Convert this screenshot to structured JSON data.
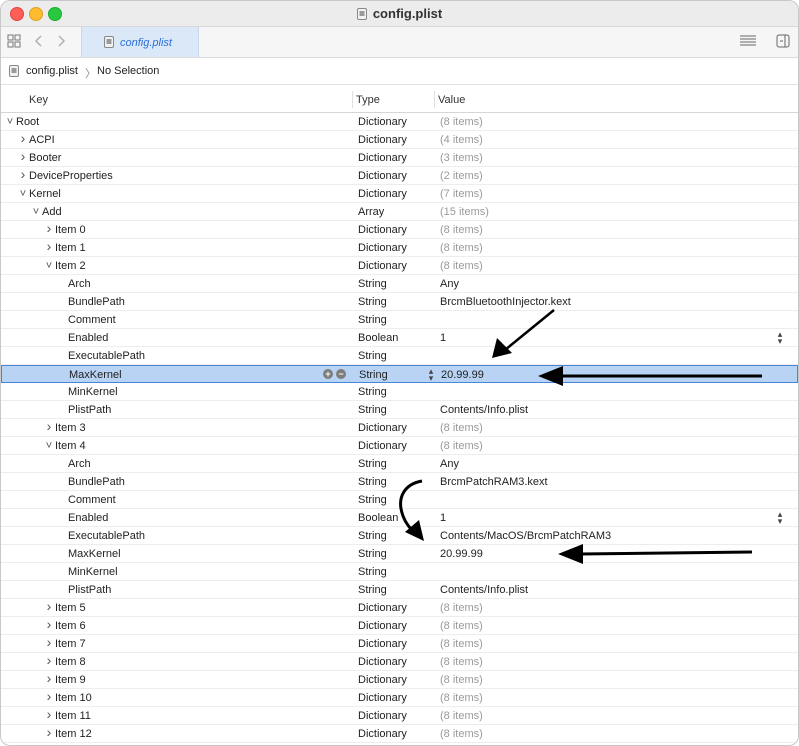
{
  "window": {
    "title": "config.plist"
  },
  "toolbar": {
    "tab_label": "config.plist",
    "grid_icon": "grid-icon",
    "back_icon": "chevron-left-icon",
    "forward_icon": "chevron-right-icon",
    "lines_icon": "lines-icon",
    "sidebar_icon": "sidebar-toggle-icon"
  },
  "breadcrumb": {
    "file": "config.plist",
    "separator": "〉",
    "selection": "No Selection"
  },
  "columns": {
    "key": "Key",
    "type": "Type",
    "value": "Value"
  },
  "rows": [
    {
      "key": "Root",
      "type": "Dictionary",
      "value": "(8 items)",
      "level": 0,
      "disc": "open"
    },
    {
      "key": "ACPI",
      "type": "Dictionary",
      "value": "(4 items)",
      "level": 1,
      "disc": "closed"
    },
    {
      "key": "Booter",
      "type": "Dictionary",
      "value": "(3 items)",
      "level": 1,
      "disc": "closed"
    },
    {
      "key": "DeviceProperties",
      "type": "Dictionary",
      "value": "(2 items)",
      "level": 1,
      "disc": "closed"
    },
    {
      "key": "Kernel",
      "type": "Dictionary",
      "value": "(7 items)",
      "level": 1,
      "disc": "open"
    },
    {
      "key": "Add",
      "type": "Array",
      "value": "(15 items)",
      "level": 2,
      "disc": "open"
    },
    {
      "key": "Item 0",
      "type": "Dictionary",
      "value": "(8 items)",
      "level": 3,
      "disc": "closed"
    },
    {
      "key": "Item 1",
      "type": "Dictionary",
      "value": "(8 items)",
      "level": 3,
      "disc": "closed"
    },
    {
      "key": "Item 2",
      "type": "Dictionary",
      "value": "(8 items)",
      "level": 3,
      "disc": "open"
    },
    {
      "key": "Arch",
      "type": "String",
      "value": "Any",
      "level": 4
    },
    {
      "key": "BundlePath",
      "type": "String",
      "value": "BrcmBluetoothInjector.kext",
      "level": 4
    },
    {
      "key": "Comment",
      "type": "String",
      "value": "",
      "level": 4
    },
    {
      "key": "Enabled",
      "type": "Boolean",
      "value": "1",
      "level": 4,
      "stepper": true
    },
    {
      "key": "ExecutablePath",
      "type": "String",
      "value": "",
      "level": 4
    },
    {
      "key": "MaxKernel",
      "type": "String",
      "value": "20.99.99",
      "level": 4,
      "selected": true
    },
    {
      "key": "MinKernel",
      "type": "String",
      "value": "",
      "level": 4
    },
    {
      "key": "PlistPath",
      "type": "String",
      "value": "Contents/Info.plist",
      "level": 4
    },
    {
      "key": "Item 3",
      "type": "Dictionary",
      "value": "(8 items)",
      "level": 3,
      "disc": "closed"
    },
    {
      "key": "Item 4",
      "type": "Dictionary",
      "value": "(8 items)",
      "level": 3,
      "disc": "open"
    },
    {
      "key": "Arch",
      "type": "String",
      "value": "Any",
      "level": 4
    },
    {
      "key": "BundlePath",
      "type": "String",
      "value": "BrcmPatchRAM3.kext",
      "level": 4
    },
    {
      "key": "Comment",
      "type": "String",
      "value": "",
      "level": 4
    },
    {
      "key": "Enabled",
      "type": "Boolean",
      "value": "1",
      "level": 4,
      "stepper": true
    },
    {
      "key": "ExecutablePath",
      "type": "String",
      "value": "Contents/MacOS/BrcmPatchRAM3",
      "level": 4
    },
    {
      "key": "MaxKernel",
      "type": "String",
      "value": "20.99.99",
      "level": 4
    },
    {
      "key": "MinKernel",
      "type": "String",
      "value": "",
      "level": 4
    },
    {
      "key": "PlistPath",
      "type": "String",
      "value": "Contents/Info.plist",
      "level": 4
    },
    {
      "key": "Item 5",
      "type": "Dictionary",
      "value": "(8 items)",
      "level": 3,
      "disc": "closed"
    },
    {
      "key": "Item 6",
      "type": "Dictionary",
      "value": "(8 items)",
      "level": 3,
      "disc": "closed"
    },
    {
      "key": "Item 7",
      "type": "Dictionary",
      "value": "(8 items)",
      "level": 3,
      "disc": "closed"
    },
    {
      "key": "Item 8",
      "type": "Dictionary",
      "value": "(8 items)",
      "level": 3,
      "disc": "closed"
    },
    {
      "key": "Item 9",
      "type": "Dictionary",
      "value": "(8 items)",
      "level": 3,
      "disc": "closed"
    },
    {
      "key": "Item 10",
      "type": "Dictionary",
      "value": "(8 items)",
      "level": 3,
      "disc": "closed"
    },
    {
      "key": "Item 11",
      "type": "Dictionary",
      "value": "(8 items)",
      "level": 3,
      "disc": "closed"
    },
    {
      "key": "Item 12",
      "type": "Dictionary",
      "value": "(8 items)",
      "level": 3,
      "disc": "closed"
    }
  ],
  "selected_row_controls": {
    "add_icon": "plus-circle-icon",
    "remove_icon": "minus-circle-icon",
    "type_stepper_icon": "up-down-stepper-icon"
  },
  "annotations": {
    "arrow_color": "#000000",
    "selection_color": "#b9d3f5",
    "accent": "#2a6fd6"
  }
}
